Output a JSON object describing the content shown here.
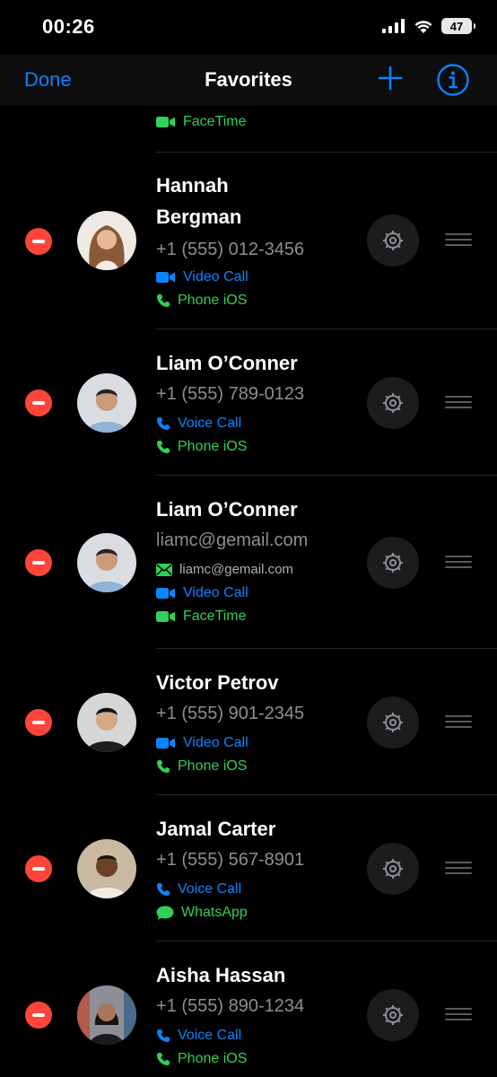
{
  "status_bar": {
    "time": "00:26",
    "battery": "47",
    "icons": [
      "cellular-signal-icon",
      "wifi-icon",
      "battery-icon"
    ]
  },
  "nav": {
    "done_label": "Done",
    "title": "Favorites",
    "add_icon": "plus-icon",
    "info_icon": "info-icon"
  },
  "colors": {
    "accent": "#0a84ff",
    "green": "#30d158",
    "delete": "#ff453a",
    "background": "#000000"
  },
  "top_partial": {
    "action": {
      "label": "FaceTime",
      "icon": "facetime-video-icon",
      "color": "green"
    }
  },
  "favorites": [
    {
      "name_lines": [
        "Hannah",
        "Bergman"
      ],
      "detail": "+1 (555) 012-3456",
      "actions": [
        {
          "label": "Video Call",
          "icon": "video-icon",
          "color": "blue"
        },
        {
          "label": "Phone iOS",
          "icon": "phone-icon",
          "color": "green"
        }
      ]
    },
    {
      "name": "Liam O’Conner",
      "detail": "+1 (555) 789-0123",
      "actions": [
        {
          "label": "Voice Call",
          "icon": "phone-icon",
          "color": "blue"
        },
        {
          "label": "Phone iOS",
          "icon": "phone-icon",
          "color": "green"
        }
      ]
    },
    {
      "name": "Liam O’Conner",
      "detail": "liamc@gemail.com",
      "actions": [
        {
          "label": "liamc@gemail.com",
          "icon": "mail-icon",
          "color": "gray"
        },
        {
          "label": "Video Call",
          "icon": "video-icon",
          "color": "blue"
        },
        {
          "label": "FaceTime",
          "icon": "facetime-video-icon",
          "color": "green"
        }
      ]
    },
    {
      "name": "Victor Petrov",
      "detail": "+1 (555) 901-2345",
      "actions": [
        {
          "label": "Video Call",
          "icon": "video-icon",
          "color": "blue"
        },
        {
          "label": "Phone iOS",
          "icon": "phone-icon",
          "color": "green"
        }
      ]
    },
    {
      "name": "Jamal Carter",
      "detail": "+1 (555) 567-8901",
      "actions": [
        {
          "label": "Voice Call",
          "icon": "phone-icon",
          "color": "blue"
        },
        {
          "label": "WhatsApp",
          "icon": "message-bubble-icon",
          "color": "green"
        }
      ]
    },
    {
      "name": "Aisha Hassan",
      "detail": "+1 (555) 890-1234",
      "actions": [
        {
          "label": "Voice Call",
          "icon": "phone-icon",
          "color": "blue"
        },
        {
          "label": "Phone iOS",
          "icon": "phone-icon",
          "color": "green"
        }
      ]
    }
  ]
}
